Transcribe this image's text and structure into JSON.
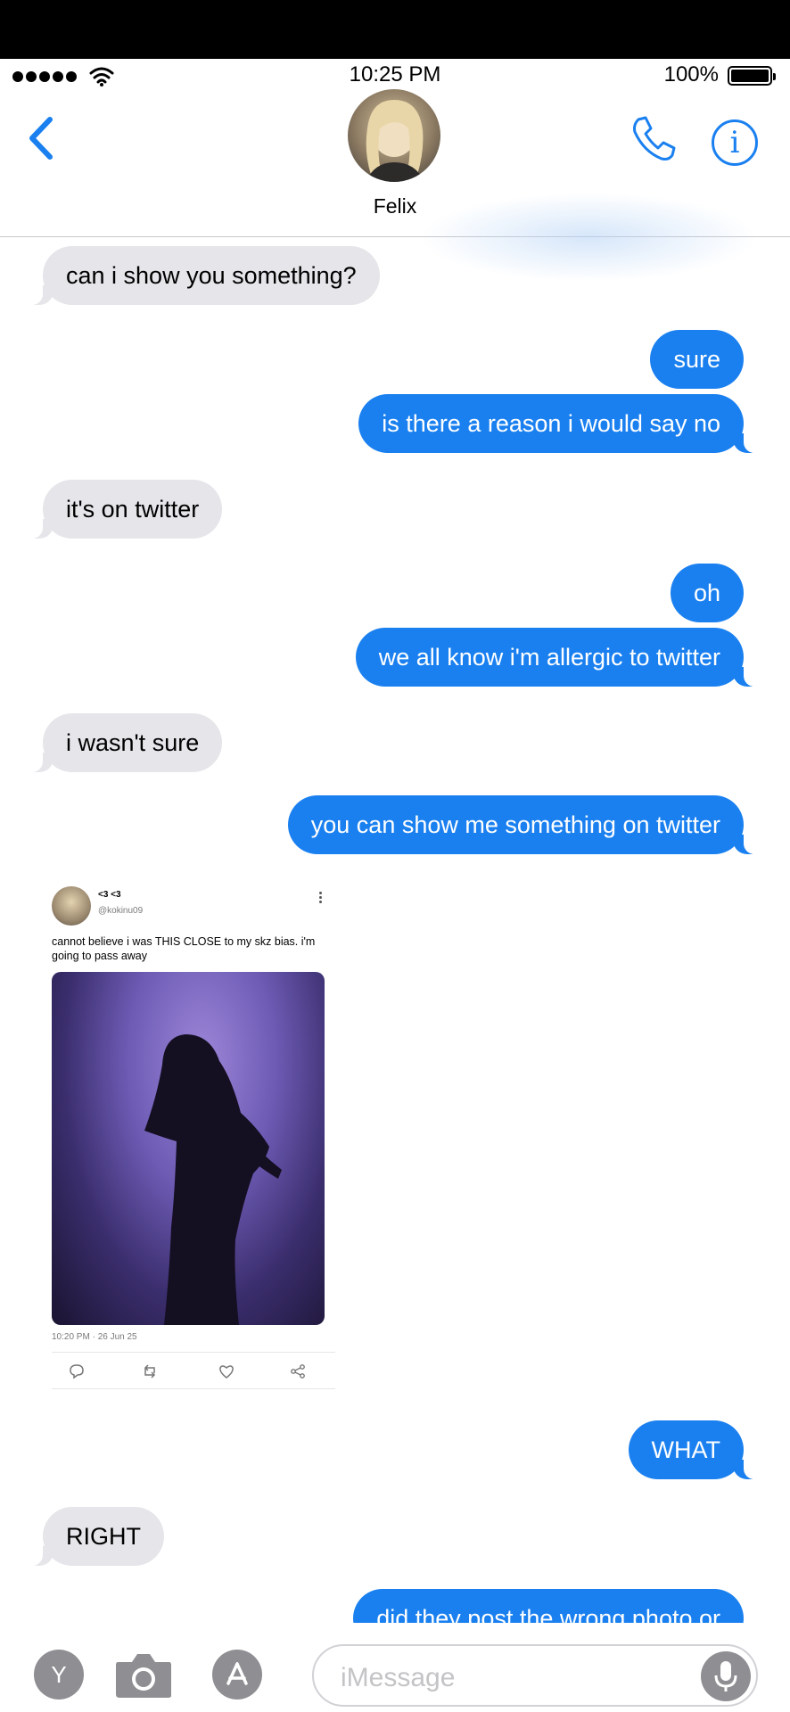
{
  "status_bar": {
    "time": "10:25 PM",
    "battery_percent": "100%",
    "battery_level": 1.0,
    "signal_bars": 5
  },
  "header": {
    "contact_name": "Felix",
    "icons": {
      "back": "chevron-left-icon",
      "call": "phone-icon",
      "info": "info-icon"
    },
    "info_glyph": "i",
    "accent_color": "#1a80f0"
  },
  "messages": [
    {
      "direction": "incoming",
      "text": "can i show you something?"
    },
    {
      "direction": "outgoing",
      "text": "sure"
    },
    {
      "direction": "outgoing",
      "text": "is there a reason i would say no"
    },
    {
      "direction": "incoming",
      "text": "it's on twitter"
    },
    {
      "direction": "outgoing",
      "text": "oh"
    },
    {
      "direction": "outgoing",
      "text": "we all know i'm allergic to twitter"
    },
    {
      "direction": "incoming",
      "text": "i wasn't sure"
    },
    {
      "direction": "outgoing",
      "text": "you can show me something on twitter"
    },
    {
      "direction": "outgoing",
      "text": "WHAT"
    },
    {
      "direction": "incoming",
      "text": "RIGHT"
    },
    {
      "direction": "outgoing",
      "text": "did they post the wrong photo or"
    }
  ],
  "tweet": {
    "display_name": "<3 <3",
    "handle": "@kokinu09",
    "text": "cannot believe i was THIS CLOSE to my skz bias. i'm going to pass away",
    "timestamp": "10:20 PM · 26 Jun 25",
    "actions": [
      "reply-icon",
      "retweet-icon",
      "like-icon",
      "share-icon"
    ]
  },
  "input_bar": {
    "app_button_label": "Y",
    "placeholder": "iMessage",
    "icons": [
      "camera-icon",
      "app-store-icon",
      "microphone-icon"
    ]
  },
  "colors": {
    "incoming_bubble": "#e5e5ea",
    "outgoing_bubble": "#1a80f0"
  }
}
